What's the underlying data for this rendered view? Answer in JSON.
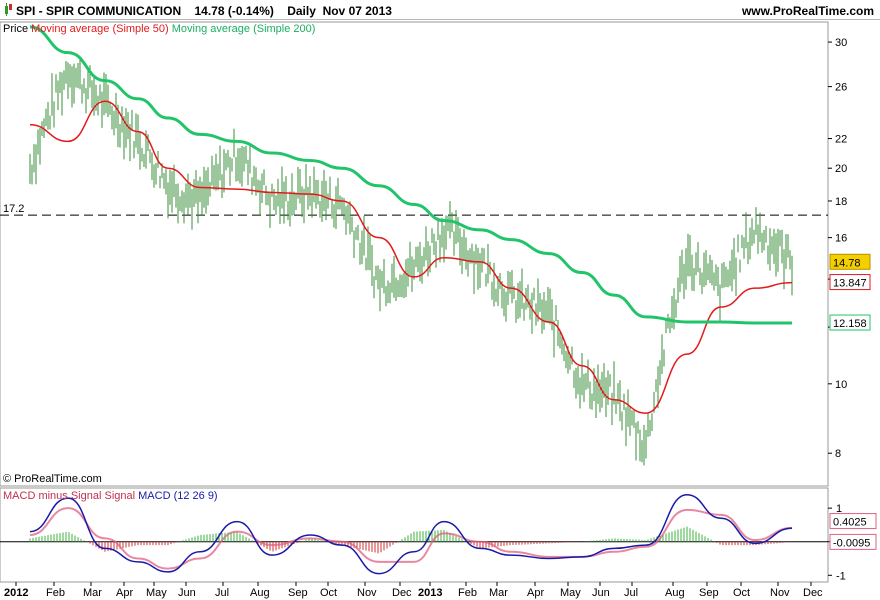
{
  "header": {
    "symbol": "SPI",
    "name": "SPIR COMMUNICATION",
    "last": "14.78",
    "change": "(-0.14%)",
    "period": "Daily",
    "date": "Nov 07 2013",
    "site": "www.ProRealTime.com"
  },
  "legend": {
    "price": "Price",
    "ma50": "Moving average (Simple 50)",
    "ma200": "Moving average (Simple 200)",
    "macd_hist": "MACD minus Signal Signal",
    "macd": "MACD (12 26 9)"
  },
  "watermark": "© ProRealTime.com",
  "colors": {
    "ma50": "#e31a1c",
    "ma200": "#22c46a",
    "price": "#3a8f3a",
    "macd": "#1a1aa8",
    "signal": "#e06080",
    "hist_pos": "#3fb03f",
    "hist_neg": "#d03030",
    "last_badge": "#f5d000"
  },
  "chart_data": [
    {
      "type": "line",
      "title": "SPI - SPIR COMMUNICATION Daily",
      "scale": "log",
      "ylim": [
        7.2,
        32
      ],
      "y_ticks": [
        8,
        10,
        12,
        14,
        16,
        18,
        20,
        22,
        26,
        30
      ],
      "y_tick_labels": [
        "8",
        "10",
        "",
        "",
        "16",
        "18",
        "20",
        "22",
        "26",
        "30"
      ],
      "x_labels": [
        "2012",
        "Feb",
        "Mar",
        "Apr",
        "May",
        "Jun",
        "Jul",
        "Aug",
        "Sep",
        "Oct",
        "Nov",
        "Dec",
        "2013",
        "Feb",
        "Mar",
        "Apr",
        "May",
        "Jun",
        "Jul",
        "Aug",
        "Sep",
        "Oct",
        "Nov",
        "Dec"
      ],
      "horizontal_line": {
        "value": 17.2,
        "label": "17.2",
        "style": "dashed"
      },
      "last_values": {
        "price": "14.78",
        "ma50": "13.847",
        "ma200": "12.158"
      },
      "series": [
        {
          "name": "Price",
          "x": [
            "2012-01",
            "2012-02",
            "2012-03",
            "2012-04",
            "2012-05",
            "2012-06",
            "2012-07",
            "2012-08",
            "2012-09",
            "2012-10",
            "2012-11",
            "2012-12",
            "2013-01",
            "2013-02",
            "2013-03",
            "2013-04",
            "2013-05",
            "2013-06",
            "2013-07",
            "2013-08",
            "2013-09",
            "2013-10",
            "2013-11"
          ],
          "values": [
            20.0,
            27.5,
            24.5,
            22.0,
            19.0,
            18.0,
            21.0,
            18.0,
            18.5,
            17.8,
            13.8,
            14.5,
            16.5,
            14.8,
            13.2,
            12.5,
            10.0,
            9.6,
            8.2,
            15.0,
            13.5,
            16.5,
            14.78
          ]
        },
        {
          "name": "Moving average (Simple 50)",
          "x": [
            "2012-01",
            "2012-02",
            "2012-03",
            "2012-04",
            "2012-05",
            "2012-06",
            "2012-07",
            "2012-08",
            "2012-09",
            "2012-10",
            "2012-11",
            "2012-12",
            "2013-01",
            "2013-02",
            "2013-03",
            "2013-04",
            "2013-05",
            "2013-06",
            "2013-07",
            "2013-08",
            "2013-09",
            "2013-10",
            "2013-11"
          ],
          "values": [
            23.0,
            21.8,
            24.8,
            22.5,
            20.0,
            18.8,
            18.7,
            18.5,
            18.4,
            18.0,
            16.0,
            14.1,
            15.0,
            14.8,
            13.6,
            12.2,
            10.6,
            9.5,
            9.1,
            11.0,
            12.8,
            13.6,
            13.847
          ]
        },
        {
          "name": "Moving average (Simple 200)",
          "x": [
            "2012-01",
            "2012-02",
            "2012-03",
            "2012-04",
            "2012-05",
            "2012-06",
            "2012-07",
            "2012-08",
            "2012-09",
            "2012-10",
            "2012-11",
            "2012-12",
            "2013-01",
            "2013-02",
            "2013-03",
            "2013-04",
            "2013-05",
            "2013-06",
            "2013-07",
            "2013-08",
            "2013-09",
            "2013-10",
            "2013-11"
          ],
          "values": [
            31.5,
            29.0,
            26.5,
            25.0,
            23.5,
            22.3,
            21.8,
            21.0,
            20.5,
            20.0,
            18.9,
            17.8,
            16.9,
            16.4,
            15.9,
            15.2,
            14.3,
            13.3,
            12.4,
            12.2,
            12.2,
            12.16,
            12.158
          ]
        }
      ]
    },
    {
      "type": "line",
      "title": "MACD (12 26 9)",
      "ylim": [
        -1.2,
        1.6
      ],
      "y_ticks": [
        -1,
        0,
        1
      ],
      "last_values": {
        "macd": "0.4025",
        "hist": "-0.0095"
      },
      "series": [
        {
          "name": "MACD (12 26 9)",
          "x": [
            "2012-01",
            "2012-02",
            "2012-03",
            "2012-04",
            "2012-05",
            "2012-06",
            "2012-07",
            "2012-08",
            "2012-09",
            "2012-10",
            "2012-11",
            "2012-12",
            "2013-01",
            "2013-02",
            "2013-03",
            "2013-04",
            "2013-05",
            "2013-06",
            "2013-07",
            "2013-08",
            "2013-09",
            "2013-10",
            "2013-11"
          ],
          "values": [
            0.3,
            1.3,
            -0.2,
            -0.6,
            -0.9,
            -0.3,
            0.6,
            -0.4,
            0.2,
            -0.1,
            -0.95,
            -0.3,
            0.6,
            -0.2,
            -0.4,
            -0.5,
            -0.45,
            -0.2,
            -0.1,
            1.4,
            0.7,
            -0.05,
            0.4025
          ]
        },
        {
          "name": "MACD minus Signal Signal",
          "x": [
            "2012-01",
            "2012-02",
            "2012-03",
            "2012-04",
            "2012-05",
            "2012-06",
            "2012-07",
            "2012-08",
            "2012-09",
            "2012-10",
            "2012-11",
            "2012-12",
            "2013-01",
            "2013-02",
            "2013-03",
            "2013-04",
            "2013-05",
            "2013-06",
            "2013-07",
            "2013-08",
            "2013-09",
            "2013-10",
            "2013-11"
          ],
          "values": [
            0.1,
            0.3,
            -0.3,
            -0.1,
            -0.1,
            0.2,
            0.3,
            -0.3,
            0.1,
            -0.1,
            -0.35,
            0.3,
            0.35,
            -0.2,
            -0.1,
            -0.05,
            0.0,
            0.1,
            0.05,
            0.45,
            -0.1,
            -0.1,
            -0.0095
          ]
        }
      ]
    }
  ]
}
